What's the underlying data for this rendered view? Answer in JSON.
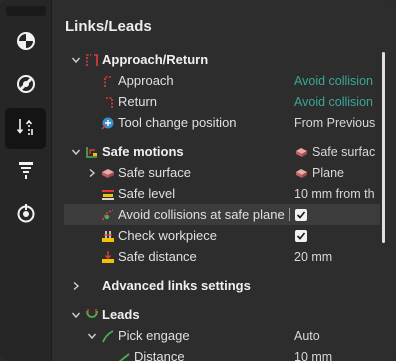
{
  "panel": {
    "title": "Links/Leads"
  },
  "toolbar": {
    "items": [
      {
        "icon": "quadrant-circle-icon"
      },
      {
        "icon": "tool-orientation-icon"
      },
      {
        "icon": "links-leads-icon",
        "active": true
      },
      {
        "icon": "funnel-tool-icon"
      },
      {
        "icon": "drop-target-icon"
      }
    ]
  },
  "tree": {
    "approach_return": {
      "label": "Approach/Return"
    },
    "approach": {
      "label": "Approach",
      "value": "Avoid collision"
    },
    "return": {
      "label": "Return",
      "value": "Avoid collision"
    },
    "tool_change": {
      "label": "Tool change position",
      "value": "From Previous"
    },
    "safe_motions": {
      "label": "Safe motions",
      "value": "Safe surfac"
    },
    "safe_surface": {
      "label": "Safe surface",
      "value": "Plane"
    },
    "safe_level": {
      "label": "Safe level",
      "value": "10 mm from th"
    },
    "avoid_collisions": {
      "label": "Avoid collisions at safe plane",
      "checked": true
    },
    "check_workpiece": {
      "label": "Check workpiece",
      "checked": true
    },
    "safe_distance": {
      "label": "Safe distance",
      "value": "20 mm"
    },
    "advanced_links": {
      "label": "Advanced links settings"
    },
    "leads": {
      "label": "Leads"
    },
    "pick_engage": {
      "label": "Pick engage",
      "value": "Auto"
    },
    "distance": {
      "label": "Distance",
      "value": "10 mm"
    }
  },
  "colors": {
    "accent": "#3aa796",
    "icon_red": "#e23b3b",
    "icon_green": "#4caf50",
    "icon_yellow": "#f2c200"
  }
}
